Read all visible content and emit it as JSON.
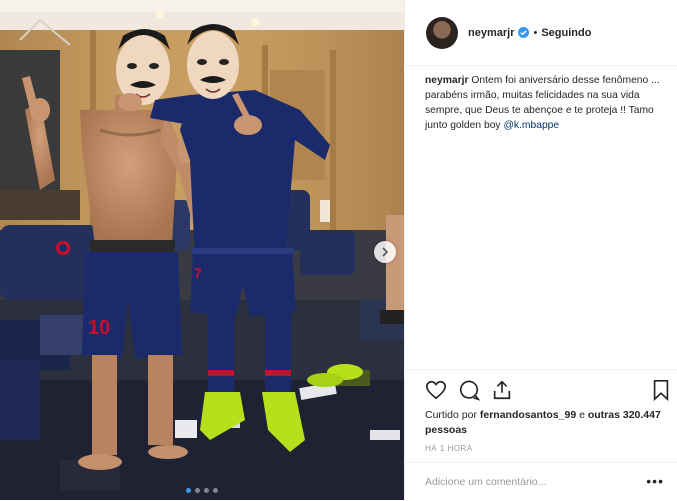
{
  "header": {
    "username": "neymarjr",
    "separator": "•",
    "follow_status": "Seguindo"
  },
  "caption": {
    "username": "neymarjr",
    "text": "Ontem foi aniversário desse fenômeno ... parabéns irmão, muitas felicidades na sua vida sempre, que Deus te abençoe e te proteja !! Tamo junto golden boy",
    "mention": "@k.mbappe"
  },
  "likes": {
    "prefix": "Curtido por",
    "first_user": "fernandosantos_99",
    "connector": "e",
    "others": "outras 320.447 pessoas"
  },
  "time_ago": "HÁ 1 HORA",
  "comment": {
    "placeholder": "Adicione um comentário...",
    "more": "•••"
  },
  "media": {
    "carousel_total": 4,
    "carousel_active": 1,
    "jersey_numbers": [
      "10",
      "7"
    ]
  },
  "colors": {
    "verified": "#3897f0",
    "kit_navy": "#1b2a6b",
    "kit_red": "#c8102e",
    "boots": "#b7e01c"
  },
  "icons": [
    "heart-icon",
    "comment-icon",
    "share-icon",
    "bookmark-icon",
    "verified-badge-icon",
    "chevron-right-icon"
  ]
}
